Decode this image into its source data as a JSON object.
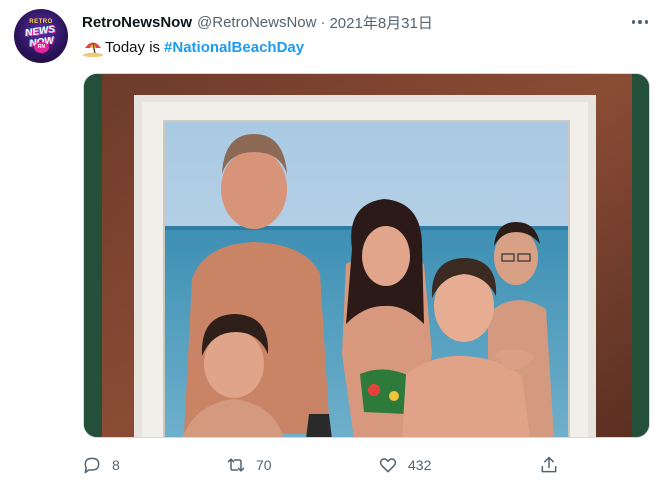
{
  "account": {
    "display_name": "RetroNewsNow",
    "handle": "@RetroNewsNow",
    "separator": "·",
    "date": "2021年8月31日",
    "avatar_lines": [
      "RETRO",
      "NEWS NOW",
      "RN"
    ]
  },
  "tweet": {
    "text_prefix": "Today is",
    "hashtag": "#NationalBeachDay",
    "emoji_icon": "beach-umbrella-icon"
  },
  "media": {
    "description_icon": "framed-family-beach-photo"
  },
  "actions": {
    "replies": "8",
    "retweets": "70",
    "likes": "432"
  },
  "colors": {
    "link": "#1d9bf0",
    "secondary_text": "#536471",
    "primary_text": "#0f1419"
  }
}
